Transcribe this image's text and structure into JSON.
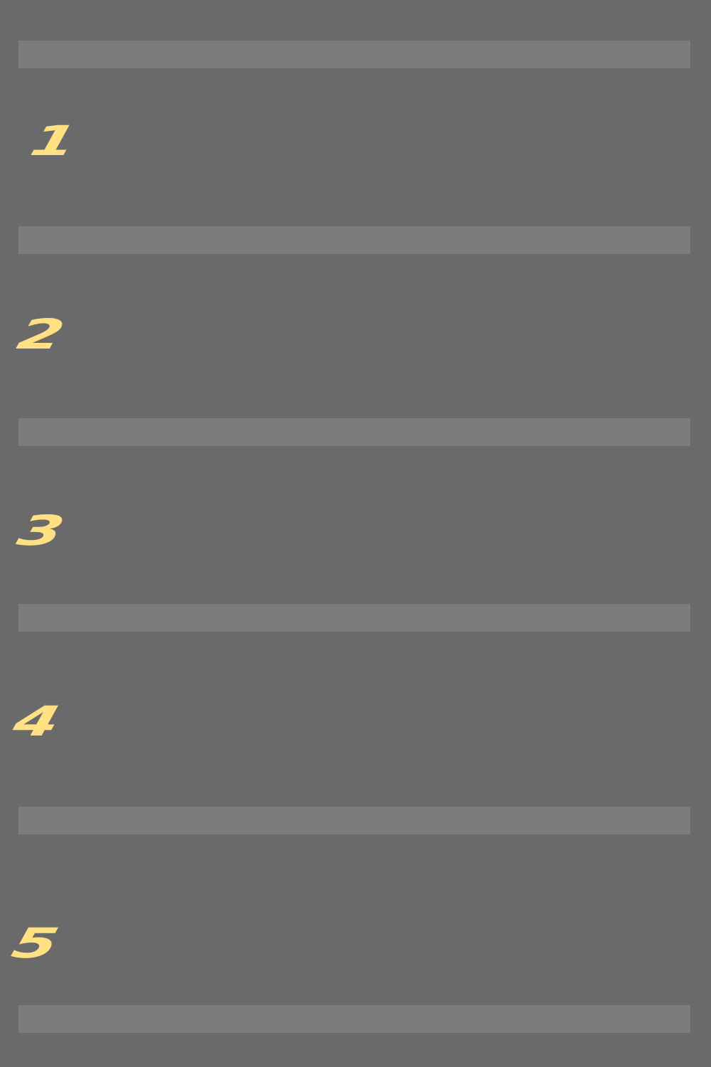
{
  "background_color": "#6a6a6a",
  "divider_color": "#7c7c7c",
  "number_color": "#ffe083",
  "rows": [
    {
      "label": "1"
    },
    {
      "label": "2"
    },
    {
      "label": "3"
    },
    {
      "label": "4"
    },
    {
      "label": "5"
    }
  ]
}
